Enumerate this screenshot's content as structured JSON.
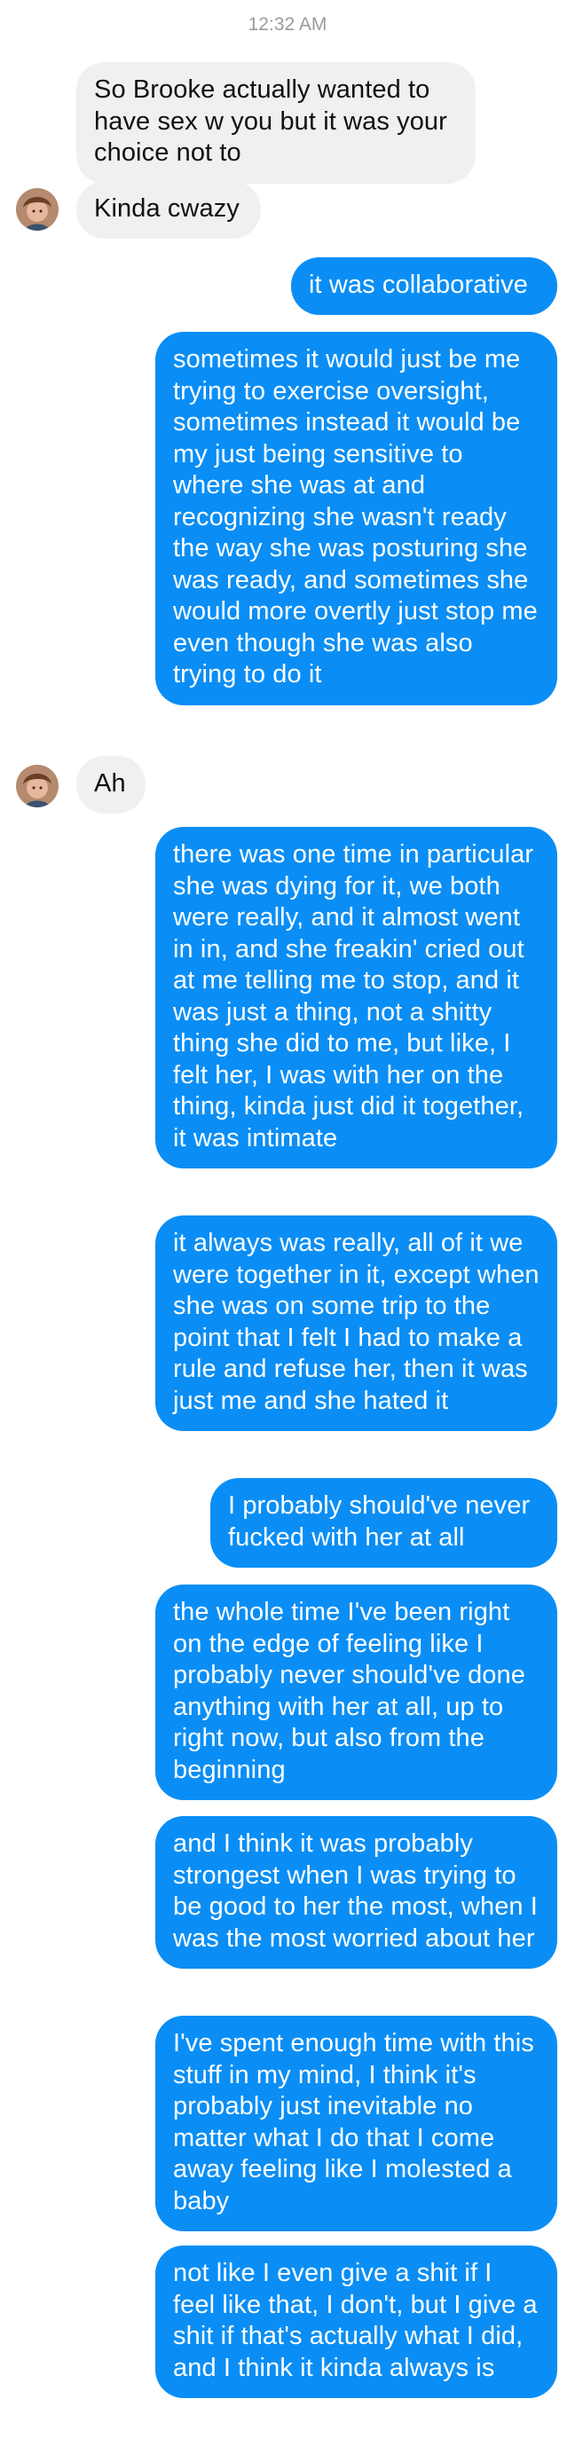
{
  "thread": {
    "timestamp": "12:32 AM",
    "messages": [
      {
        "dir": "in",
        "text": "So Brooke actually wanted to have sex w you but it was your choice not to"
      },
      {
        "dir": "in",
        "text": "Kinda cwazy"
      },
      {
        "dir": "out",
        "text": "it was collaborative"
      },
      {
        "dir": "out",
        "text": "sometimes it would just be me trying to exercise oversight, sometimes instead it would be my just being sensitive to where she was at and recognizing she wasn't ready the way she was posturing she was ready, and sometimes she would more overtly just stop me even though she was also trying to do it"
      },
      {
        "dir": "in",
        "text": "Ah"
      },
      {
        "dir": "out",
        "text": "there was one time in particular she was dying for it, we both were really, and it almost went in in, and she freakin' cried out at me telling me to stop, and it was just a thing, not a shitty thing she did to me, but like, I felt her, I was with her on the thing, kinda just did it together, it was intimate"
      },
      {
        "dir": "out",
        "text": "it always was really, all of it we were together in it, except when she was on some trip to the point that I felt I had to make a rule and refuse her, then it was just me and she hated it"
      },
      {
        "dir": "out",
        "text": "I probably should've never fucked with her at all"
      },
      {
        "dir": "out",
        "text": "the whole time I've been right on the edge of feeling like I probably never should've done anything with her at all, up to right now, but also from the beginning"
      },
      {
        "dir": "out",
        "text": "and I think it was probably strongest when I was trying to be good to her the most, when I was the most worried about her"
      },
      {
        "dir": "out",
        "text": "I've spent enough time with this stuff in my mind, I think it's probably just inevitable no matter what I do that I come away feeling like I molested a baby"
      },
      {
        "dir": "out",
        "text": "not like I even give a shit if I feel like that, I don't, but I give a shit if that's actually what I did, and I think it kinda always is"
      }
    ]
  },
  "colors": {
    "outgoing_bubble": "#0a8ef5",
    "incoming_bubble": "#f0f0f0",
    "timestamp_text": "#9a9a9a"
  },
  "icons": {
    "contact_avatar": "contact-avatar-photo"
  }
}
